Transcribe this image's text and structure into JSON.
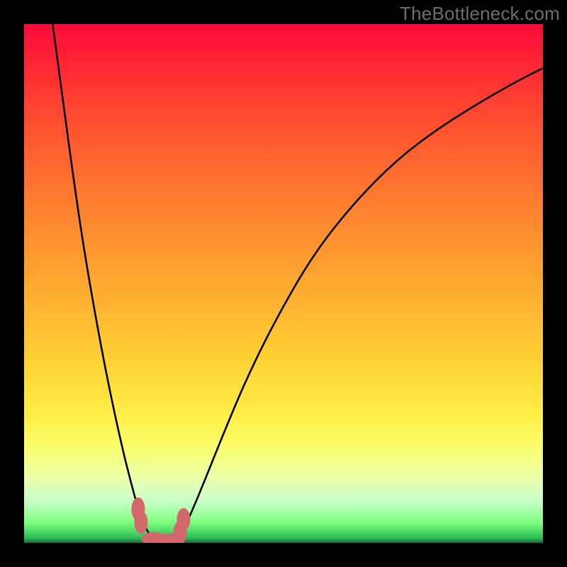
{
  "watermark": {
    "text": "TheBottleneck.com"
  },
  "chart_data": {
    "type": "line",
    "title": "",
    "xlabel": "",
    "ylabel": "",
    "xlim": [
      0,
      100
    ],
    "ylim": [
      0,
      100
    ],
    "grid": false,
    "legend": false,
    "background_gradient": {
      "stops": [
        {
          "pct": 0,
          "color": "#ff0a3a"
        },
        {
          "pct": 10,
          "color": "#ff2f33"
        },
        {
          "pct": 22,
          "color": "#ff5930"
        },
        {
          "pct": 35,
          "color": "#ff8030"
        },
        {
          "pct": 50,
          "color": "#ffa830"
        },
        {
          "pct": 65,
          "color": "#ffd235"
        },
        {
          "pct": 76,
          "color": "#fff04a"
        },
        {
          "pct": 82,
          "color": "#faff70"
        },
        {
          "pct": 88,
          "color": "#e8ffb0"
        },
        {
          "pct": 92,
          "color": "#c8ffc8"
        },
        {
          "pct": 96,
          "color": "#80ff80"
        },
        {
          "pct": 99,
          "color": "#2fbf55"
        },
        {
          "pct": 100,
          "color": "#1e6638"
        }
      ]
    },
    "series": [
      {
        "name": "bottleneck-curve",
        "color": "#000000",
        "points": [
          {
            "x": 5.5,
            "y": 100.0
          },
          {
            "x": 7.0,
            "y": 89.0
          },
          {
            "x": 9.0,
            "y": 74.0
          },
          {
            "x": 11.0,
            "y": 60.0
          },
          {
            "x": 13.0,
            "y": 48.0
          },
          {
            "x": 15.0,
            "y": 37.0
          },
          {
            "x": 17.0,
            "y": 27.0
          },
          {
            "x": 19.0,
            "y": 18.0
          },
          {
            "x": 20.5,
            "y": 12.0
          },
          {
            "x": 22.0,
            "y": 6.5
          },
          {
            "x": 23.5,
            "y": 2.5
          },
          {
            "x": 25.0,
            "y": 0.8
          },
          {
            "x": 26.5,
            "y": 0.3
          },
          {
            "x": 28.0,
            "y": 0.3
          },
          {
            "x": 29.5,
            "y": 1.0
          },
          {
            "x": 31.0,
            "y": 3.0
          },
          {
            "x": 34.0,
            "y": 10.0
          },
          {
            "x": 38.0,
            "y": 20.0
          },
          {
            "x": 43.0,
            "y": 32.0
          },
          {
            "x": 49.0,
            "y": 44.0
          },
          {
            "x": 56.0,
            "y": 56.0
          },
          {
            "x": 64.0,
            "y": 66.0
          },
          {
            "x": 72.0,
            "y": 74.0
          },
          {
            "x": 80.0,
            "y": 80.0
          },
          {
            "x": 88.0,
            "y": 85.0
          },
          {
            "x": 95.0,
            "y": 89.0
          },
          {
            "x": 100.0,
            "y": 91.5
          }
        ]
      }
    ],
    "markers": [
      {
        "x": 22.0,
        "y": 6.5,
        "rx": 1.3,
        "ry": 2.2,
        "color": "#d2686c"
      },
      {
        "x": 22.6,
        "y": 4.0,
        "rx": 1.3,
        "ry": 2.2,
        "color": "#d2686c"
      },
      {
        "x": 25.0,
        "y": 0.8,
        "rx": 2.4,
        "ry": 1.3,
        "color": "#d2686c"
      },
      {
        "x": 28.0,
        "y": 0.5,
        "rx": 2.4,
        "ry": 1.3,
        "color": "#d2686c"
      },
      {
        "x": 30.0,
        "y": 2.0,
        "rx": 1.3,
        "ry": 2.2,
        "color": "#d2686c"
      },
      {
        "x": 30.8,
        "y": 4.5,
        "rx": 1.3,
        "ry": 2.2,
        "color": "#d2686c"
      }
    ]
  }
}
